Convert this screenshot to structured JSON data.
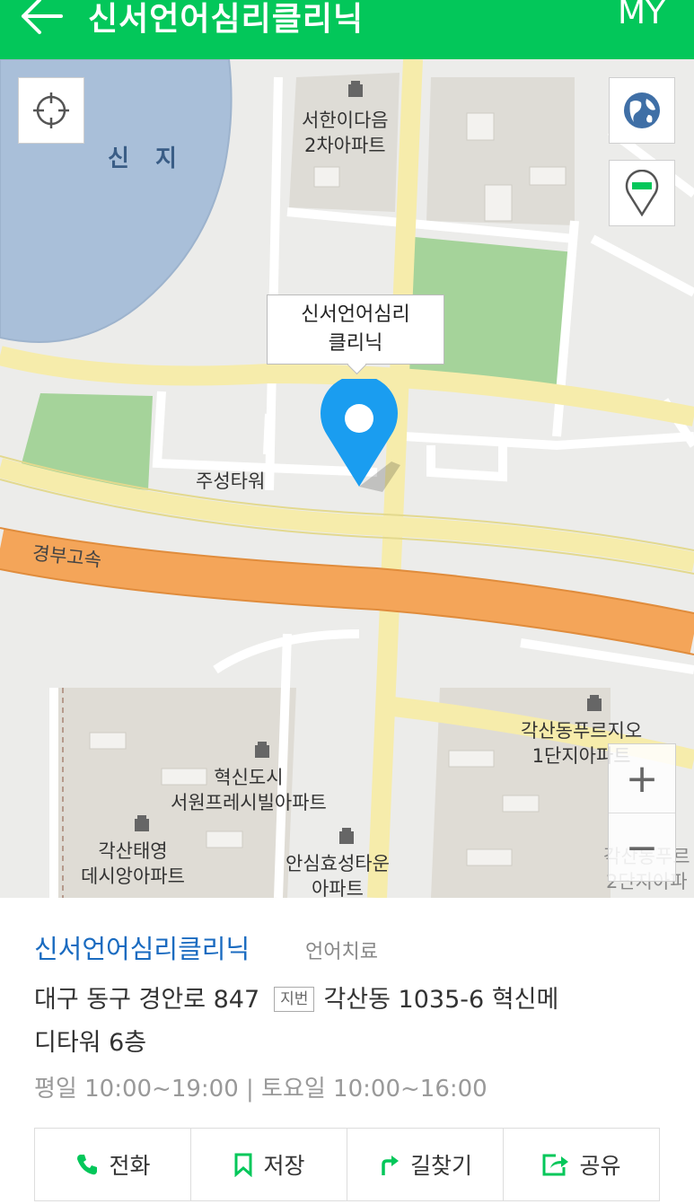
{
  "header": {
    "title": "신서언어심리클리닉",
    "my_label": "MY",
    "back_icon": "arrow-left-icon",
    "background": "#03c75a"
  },
  "map": {
    "lake_label": "신 지",
    "expressway_label": "경부고속",
    "callout": {
      "line1": "신서언어심리",
      "line2": "클리닉"
    },
    "labels": {
      "seohan_1": "서한이다음",
      "seohan_2": "2차아파트",
      "jusung": "주성타워",
      "gaksan_purujio_1": "각산동푸르지오",
      "gaksan_purujio_2": "1단지아파트",
      "hyeoksin_1": "혁신도시",
      "hyeoksin_2": "서원프레시빌아파트",
      "gaksan_taeyoung_1": "각산태영",
      "gaksan_taeyoung_2": "데시앙아파트",
      "ansim_1": "안심효성타운",
      "ansim_2": "아파트",
      "second_danji_1": "각산동푸르",
      "second_danji_2": "2단지아파"
    },
    "zoom_in": "+",
    "zoom_out": "−",
    "pin_color": "#1a9df0"
  },
  "place": {
    "name": "신서언어심리클리닉",
    "category": "언어치료",
    "road_address": "대구 동구 경안로 847",
    "jibun_badge": "지번",
    "jibun_address_part1": "각산동 1035-6 혁신메",
    "jibun_address_part2": "디타워 6층",
    "hours": "평일 10:00~19:00 | 토요일 10:00~16:00"
  },
  "actions": [
    {
      "label": "전화",
      "icon": "phone-icon"
    },
    {
      "label": "저장",
      "icon": "bookmark-icon"
    },
    {
      "label": "길찾기",
      "icon": "directions-icon"
    },
    {
      "label": "공유",
      "icon": "share-icon"
    }
  ],
  "colors": {
    "accent_green": "#03c75a",
    "link_blue": "#1a6bc0"
  }
}
